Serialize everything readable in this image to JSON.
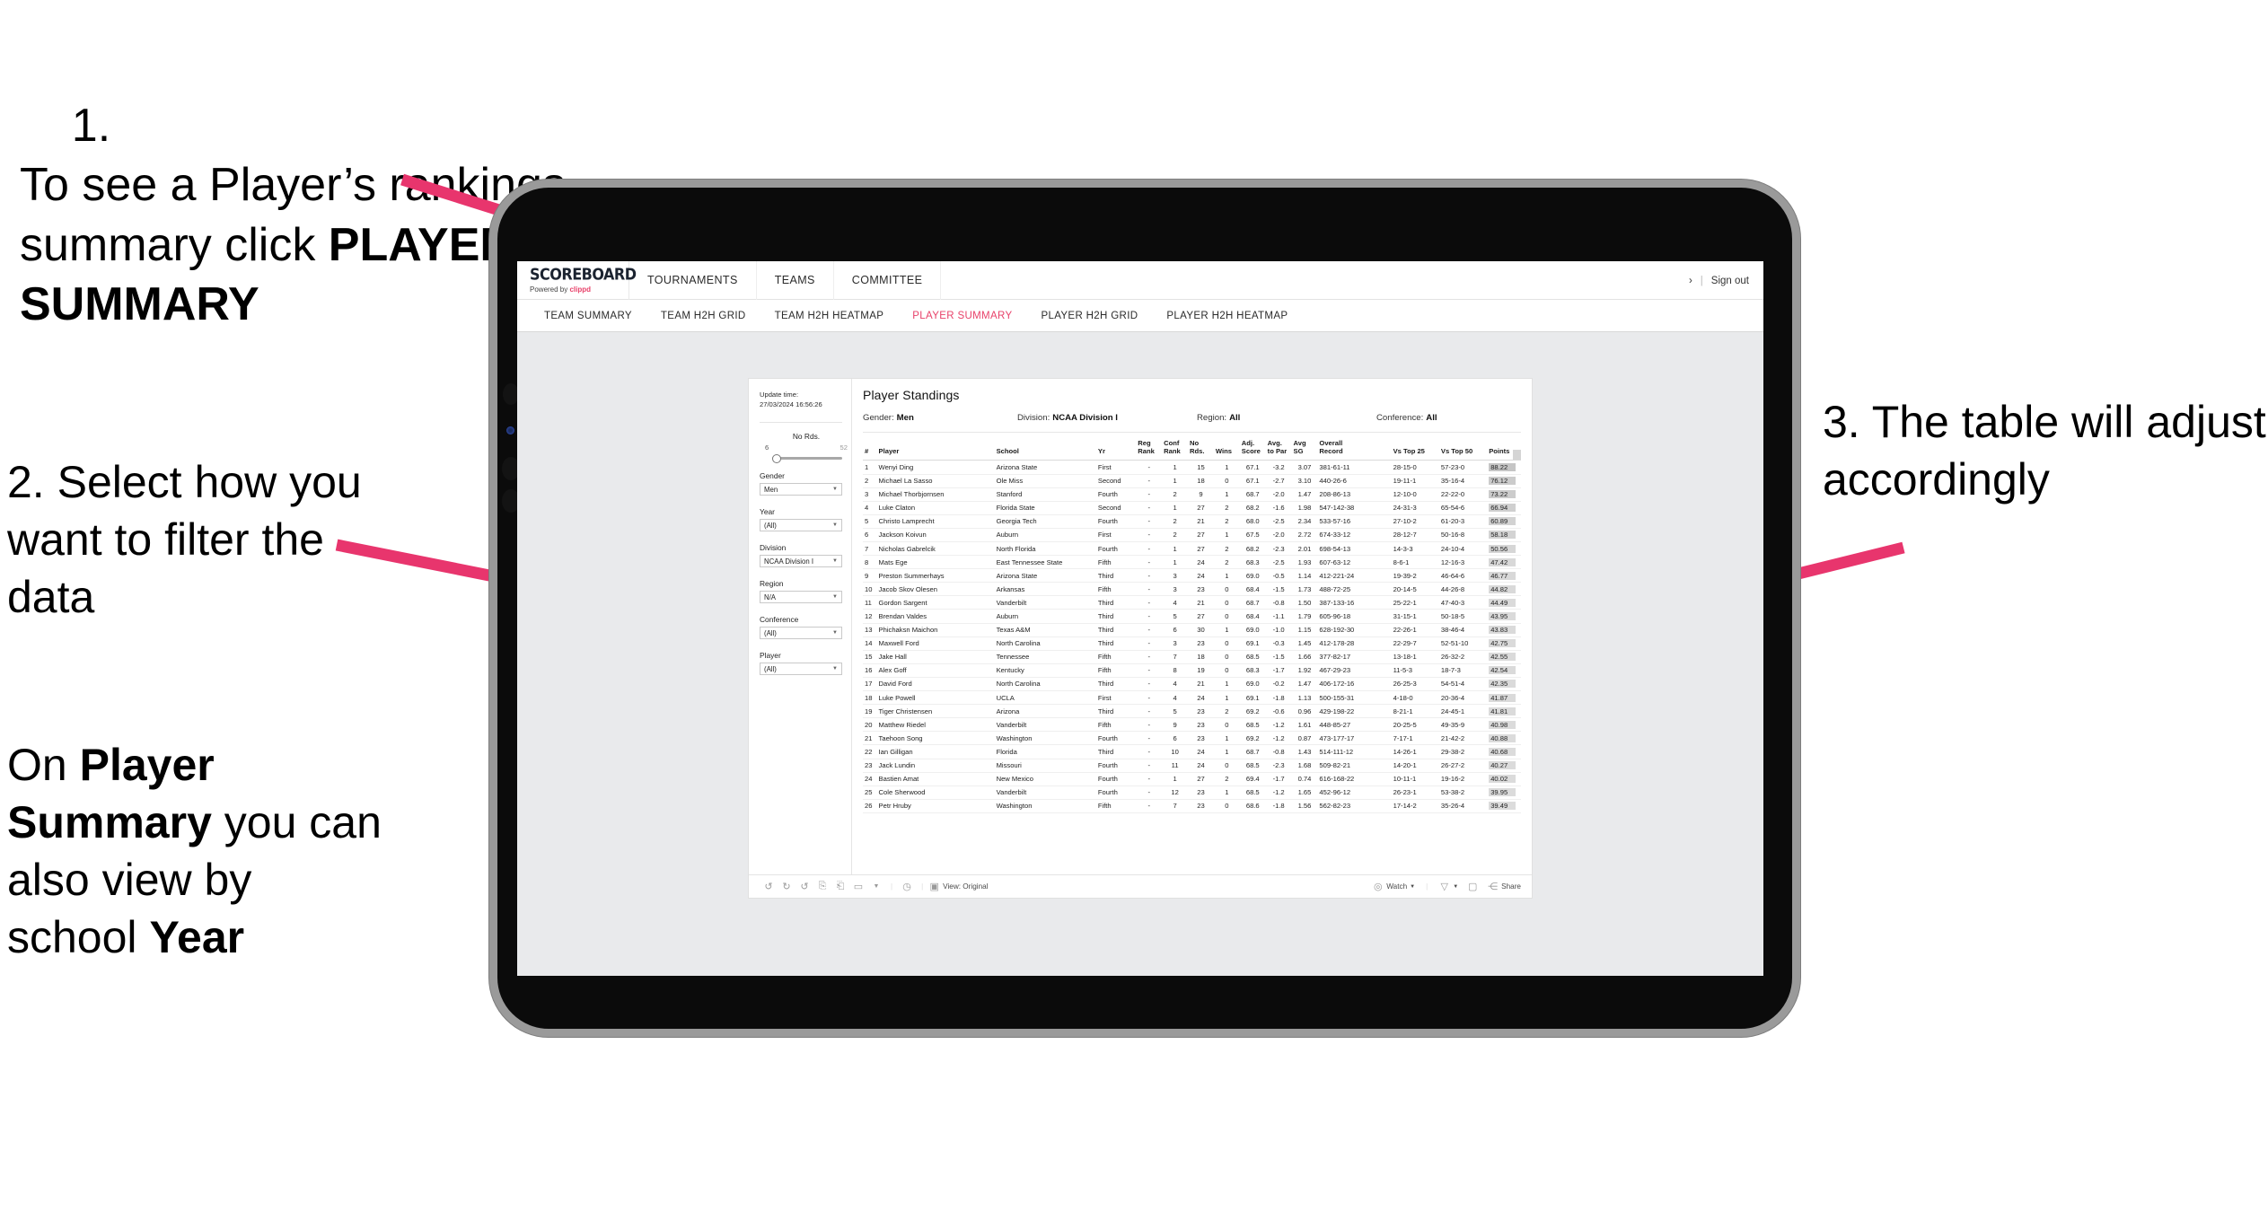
{
  "annotations": {
    "step1_num": "1.",
    "step1_text_a": "To see a Player’s rankings summary click ",
    "step1_bold": "PLAYER SUMMARY",
    "step2": "2. Select how you want to filter the data",
    "step2b_a": "On ",
    "step2b_b1": "Player Summary",
    "step2b_c": " you can also view by school ",
    "step2b_b2": "Year",
    "step3": "3. The table will adjust accordingly",
    "arrow_color": "#e8356d"
  },
  "app": {
    "brand": {
      "name": "SCOREBOARD",
      "powered_prefix": "Powered by ",
      "powered_by": "clippd"
    },
    "top_nav": [
      "TOURNAMENTS",
      "TEAMS",
      "COMMITTEE"
    ],
    "top_right": {
      "chevron": "›",
      "separator": "|",
      "sign_out": "Sign out"
    },
    "sub_nav": [
      {
        "label": "TEAM SUMMARY",
        "active": false
      },
      {
        "label": "TEAM H2H GRID",
        "active": false
      },
      {
        "label": "TEAM H2H HEATMAP",
        "active": false
      },
      {
        "label": "PLAYER SUMMARY",
        "active": true
      },
      {
        "label": "PLAYER H2H GRID",
        "active": false
      },
      {
        "label": "PLAYER H2H HEATMAP",
        "active": false
      }
    ],
    "accent_color": "#e8426a"
  },
  "filters": {
    "update_time_label": "Update time:",
    "update_time_value": "27/03/2024 16:56:26",
    "slider": {
      "label": "No Rds.",
      "min": "6",
      "max": "52",
      "value_pct": 6
    },
    "fields": [
      {
        "label": "Gender",
        "value": "Men"
      },
      {
        "label": "Year",
        "value": "(All)"
      },
      {
        "label": "Division",
        "value": "NCAA Division I"
      },
      {
        "label": "Region",
        "value": "N/A"
      },
      {
        "label": "Conference",
        "value": "(All)"
      },
      {
        "label": "Player",
        "value": "(All)"
      }
    ]
  },
  "standings": {
    "title": "Player Standings",
    "summary": [
      {
        "key": "Gender:",
        "value": "Men"
      },
      {
        "key": "Division:",
        "value": "NCAA Division I"
      },
      {
        "key": "Region:",
        "value": "All"
      },
      {
        "key": "Conference:",
        "value": "All"
      }
    ],
    "columns": [
      {
        "l1": "#",
        "l2": ""
      },
      {
        "l1": "Player",
        "l2": ""
      },
      {
        "l1": "School",
        "l2": ""
      },
      {
        "l1": "Yr",
        "l2": ""
      },
      {
        "l1": "Reg",
        "l2": "Rank"
      },
      {
        "l1": "Conf",
        "l2": "Rank"
      },
      {
        "l1": "No",
        "l2": "Rds."
      },
      {
        "l1": "Wins",
        "l2": ""
      },
      {
        "l1": "Adj.",
        "l2": "Score"
      },
      {
        "l1": "Avg.",
        "l2": "to Par"
      },
      {
        "l1": "Avg",
        "l2": "SG"
      },
      {
        "l1": "Overall",
        "l2": "Record"
      },
      {
        "l1": "Vs Top 25",
        "l2": ""
      },
      {
        "l1": "Vs Top 50",
        "l2": ""
      },
      {
        "l1": "Points",
        "l2": ""
      }
    ],
    "rows": [
      [
        "1",
        "Wenyi Ding",
        "Arizona State",
        "First",
        "-",
        "1",
        "15",
        "1",
        "67.1",
        "-3.2",
        "3.07",
        "381-61-11",
        "28-15-0",
        "57-23-0",
        "88.22"
      ],
      [
        "2",
        "Michael La Sasso",
        "Ole Miss",
        "Second",
        "-",
        "1",
        "18",
        "0",
        "67.1",
        "-2.7",
        "3.10",
        "440-26-6",
        "19-11-1",
        "35-16-4",
        "76.12"
      ],
      [
        "3",
        "Michael Thorbjornsen",
        "Stanford",
        "Fourth",
        "-",
        "2",
        "9",
        "1",
        "68.7",
        "-2.0",
        "1.47",
        "208-86-13",
        "12-10-0",
        "22-22-0",
        "73.22"
      ],
      [
        "4",
        "Luke Claton",
        "Florida State",
        "Second",
        "-",
        "1",
        "27",
        "2",
        "68.2",
        "-1.6",
        "1.98",
        "547-142-38",
        "24-31-3",
        "65-54-6",
        "66.94"
      ],
      [
        "5",
        "Christo Lamprecht",
        "Georgia Tech",
        "Fourth",
        "-",
        "2",
        "21",
        "2",
        "68.0",
        "-2.5",
        "2.34",
        "533-57-16",
        "27-10-2",
        "61-20-3",
        "60.89"
      ],
      [
        "6",
        "Jackson Koivun",
        "Auburn",
        "First",
        "-",
        "2",
        "27",
        "1",
        "67.5",
        "-2.0",
        "2.72",
        "674-33-12",
        "28-12-7",
        "50-16-8",
        "58.18"
      ],
      [
        "7",
        "Nicholas Gabrelcik",
        "North Florida",
        "Fourth",
        "-",
        "1",
        "27",
        "2",
        "68.2",
        "-2.3",
        "2.01",
        "698-54-13",
        "14-3-3",
        "24-10-4",
        "50.56"
      ],
      [
        "8",
        "Mats Ege",
        "East Tennessee State",
        "Fifth",
        "-",
        "1",
        "24",
        "2",
        "68.3",
        "-2.5",
        "1.93",
        "607-63-12",
        "8-6-1",
        "12-16-3",
        "47.42"
      ],
      [
        "9",
        "Preston Summerhays",
        "Arizona State",
        "Third",
        "-",
        "3",
        "24",
        "1",
        "69.0",
        "-0.5",
        "1.14",
        "412-221-24",
        "19-39-2",
        "46-64-6",
        "46.77"
      ],
      [
        "10",
        "Jacob Skov Olesen",
        "Arkansas",
        "Fifth",
        "-",
        "3",
        "23",
        "0",
        "68.4",
        "-1.5",
        "1.73",
        "488-72-25",
        "20-14-5",
        "44-26-8",
        "44.82"
      ],
      [
        "11",
        "Gordon Sargent",
        "Vanderbilt",
        "Third",
        "-",
        "4",
        "21",
        "0",
        "68.7",
        "-0.8",
        "1.50",
        "387-133-16",
        "25-22-1",
        "47-40-3",
        "44.49"
      ],
      [
        "12",
        "Brendan Valdes",
        "Auburn",
        "Third",
        "-",
        "5",
        "27",
        "0",
        "68.4",
        "-1.1",
        "1.79",
        "605-96-18",
        "31-15-1",
        "50-18-5",
        "43.95"
      ],
      [
        "13",
        "Phichaksn Maichon",
        "Texas A&M",
        "Third",
        "-",
        "6",
        "30",
        "1",
        "69.0",
        "-1.0",
        "1.15",
        "628-192-30",
        "22-26-1",
        "38-46-4",
        "43.83"
      ],
      [
        "14",
        "Maxwell Ford",
        "North Carolina",
        "Third",
        "-",
        "3",
        "23",
        "0",
        "69.1",
        "-0.3",
        "1.45",
        "412-178-28",
        "22-29-7",
        "52-51-10",
        "42.75"
      ],
      [
        "15",
        "Jake Hall",
        "Tennessee",
        "Fifth",
        "-",
        "7",
        "18",
        "0",
        "68.5",
        "-1.5",
        "1.66",
        "377-82-17",
        "13-18-1",
        "26-32-2",
        "42.55"
      ],
      [
        "16",
        "Alex Goff",
        "Kentucky",
        "Fifth",
        "-",
        "8",
        "19",
        "0",
        "68.3",
        "-1.7",
        "1.92",
        "467-29-23",
        "11-5-3",
        "18-7-3",
        "42.54"
      ],
      [
        "17",
        "David Ford",
        "North Carolina",
        "Third",
        "-",
        "4",
        "21",
        "1",
        "69.0",
        "-0.2",
        "1.47",
        "406-172-16",
        "26-25-3",
        "54-51-4",
        "42.35"
      ],
      [
        "18",
        "Luke Powell",
        "UCLA",
        "First",
        "-",
        "4",
        "24",
        "1",
        "69.1",
        "-1.8",
        "1.13",
        "500-155-31",
        "4-18-0",
        "20-36-4",
        "41.87"
      ],
      [
        "19",
        "Tiger Christensen",
        "Arizona",
        "Third",
        "-",
        "5",
        "23",
        "2",
        "69.2",
        "-0.6",
        "0.96",
        "429-198-22",
        "8-21-1",
        "24-45-1",
        "41.81"
      ],
      [
        "20",
        "Matthew Riedel",
        "Vanderbilt",
        "Fifth",
        "-",
        "9",
        "23",
        "0",
        "68.5",
        "-1.2",
        "1.61",
        "448-85-27",
        "20-25-5",
        "49-35-9",
        "40.98"
      ],
      [
        "21",
        "Taehoon Song",
        "Washington",
        "Fourth",
        "-",
        "6",
        "23",
        "1",
        "69.2",
        "-1.2",
        "0.87",
        "473-177-17",
        "7-17-1",
        "21-42-2",
        "40.88"
      ],
      [
        "22",
        "Ian Gilligan",
        "Florida",
        "Third",
        "-",
        "10",
        "24",
        "1",
        "68.7",
        "-0.8",
        "1.43",
        "514-111-12",
        "14-26-1",
        "29-38-2",
        "40.68"
      ],
      [
        "23",
        "Jack Lundin",
        "Missouri",
        "Fourth",
        "-",
        "11",
        "24",
        "0",
        "68.5",
        "-2.3",
        "1.68",
        "509-82-21",
        "14-20-1",
        "26-27-2",
        "40.27"
      ],
      [
        "24",
        "Bastien Amat",
        "New Mexico",
        "Fourth",
        "-",
        "1",
        "27",
        "2",
        "69.4",
        "-1.7",
        "0.74",
        "616-168-22",
        "10-11-1",
        "19-16-2",
        "40.02"
      ],
      [
        "25",
        "Cole Sherwood",
        "Vanderbilt",
        "Fourth",
        "-",
        "12",
        "23",
        "1",
        "68.5",
        "-1.2",
        "1.65",
        "452-96-12",
        "26-23-1",
        "53-38-2",
        "39.95"
      ],
      [
        "26",
        "Petr Hruby",
        "Washington",
        "Fifth",
        "-",
        "7",
        "23",
        "0",
        "68.6",
        "-1.8",
        "1.56",
        "562-82-23",
        "17-14-2",
        "35-26-4",
        "39.49"
      ]
    ],
    "points_max": 88.22
  },
  "toolbar": {
    "view_label": "View: Original",
    "watch_label": "Watch",
    "share_label": "Share",
    "caret": "▾",
    "icons": [
      "undo-icon",
      "redo-icon",
      "revert-icon",
      "refresh-data-icon",
      "pause-auto-update-icon",
      "device-layout-icon",
      "clear-icon",
      "view-original-icon",
      "watch-icon",
      "alert-icon",
      "device-preview-icon",
      "share-icon"
    ]
  }
}
